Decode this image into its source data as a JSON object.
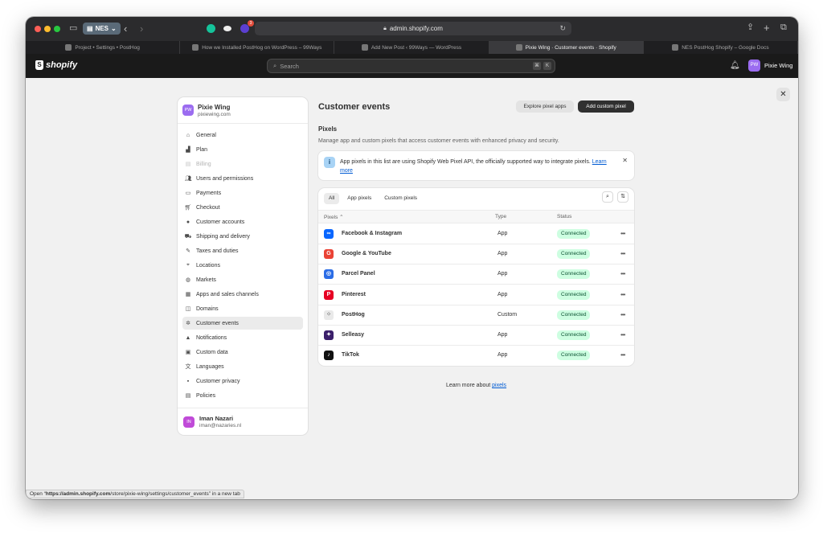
{
  "browser": {
    "profile": "NES",
    "extension_badge": "3",
    "address": "admin.shopify.com",
    "tabs": [
      {
        "label": "Project • Settings • PostHog",
        "active": false
      },
      {
        "label": "How we Installed PostHog on WordPress – 99Ways",
        "active": false
      },
      {
        "label": "Add New Post ‹ 99Ways — WordPress",
        "active": false
      },
      {
        "label": "Pixie Wing · Customer events · Shopify",
        "active": true
      },
      {
        "label": "NES PostHog Shopify – Google Docs",
        "active": false
      }
    ]
  },
  "topbar": {
    "logo": "shopify",
    "search_placeholder": "Search",
    "shortcut_keys": [
      "⌘",
      "K"
    ],
    "user_initials": "PW",
    "user_name": "Pixie Wing"
  },
  "sidebar": {
    "store_initials": "PW",
    "store_name": "Pixie Wing",
    "store_domain": "pixiewing.com",
    "items": [
      {
        "label": "General",
        "icon": "store-icon"
      },
      {
        "label": "Plan",
        "icon": "chart-icon"
      },
      {
        "label": "Billing",
        "icon": "receipt-icon",
        "disabled": true
      },
      {
        "label": "Users and permissions",
        "icon": "users-icon"
      },
      {
        "label": "Payments",
        "icon": "payment-icon"
      },
      {
        "label": "Checkout",
        "icon": "cart-icon"
      },
      {
        "label": "Customer accounts",
        "icon": "person-icon"
      },
      {
        "label": "Shipping and delivery",
        "icon": "truck-icon"
      },
      {
        "label": "Taxes and duties",
        "icon": "tax-icon"
      },
      {
        "label": "Locations",
        "icon": "location-icon"
      },
      {
        "label": "Markets",
        "icon": "globe-icon"
      },
      {
        "label": "Apps and sales channels",
        "icon": "apps-icon"
      },
      {
        "label": "Domains",
        "icon": "domain-icon"
      },
      {
        "label": "Customer events",
        "icon": "events-icon",
        "active": true
      },
      {
        "label": "Notifications",
        "icon": "bell-icon"
      },
      {
        "label": "Custom data",
        "icon": "data-icon"
      },
      {
        "label": "Languages",
        "icon": "language-icon"
      },
      {
        "label": "Customer privacy",
        "icon": "lock-icon"
      },
      {
        "label": "Policies",
        "icon": "policy-icon"
      }
    ],
    "user_initials": "IN",
    "user_name": "Iman Nazari",
    "user_email": "iman@nazaries.nl"
  },
  "main": {
    "title": "Customer events",
    "explore_button": "Explore pixel apps",
    "add_button": "Add custom pixel",
    "section_title": "Pixels",
    "section_description": "Manage app and custom pixels that access customer events with enhanced privacy and security.",
    "banner_text": "App pixels in this list are using Shopify Web Pixel API, the officially supported way to integrate pixels.",
    "banner_link": "Learn more",
    "filters": [
      {
        "label": "All",
        "active": true
      },
      {
        "label": "App pixels",
        "active": false
      },
      {
        "label": "Custom pixels",
        "active": false
      }
    ],
    "columns": {
      "pixels": "Pixels",
      "type": "Type",
      "status": "Status"
    },
    "pixels": [
      {
        "name": "Facebook & Instagram",
        "type": "App",
        "status": "Connected",
        "icon": "meta-icon",
        "color": "#0866ff",
        "glyph": "∞"
      },
      {
        "name": "Google & YouTube",
        "type": "App",
        "status": "Connected",
        "icon": "google-icon",
        "color": "#ea4335",
        "glyph": "G"
      },
      {
        "name": "Parcel Panel",
        "type": "App",
        "status": "Connected",
        "icon": "parcel-panel-icon",
        "color": "#2b6de6",
        "glyph": "◎"
      },
      {
        "name": "Pinterest",
        "type": "App",
        "status": "Connected",
        "icon": "pinterest-icon",
        "color": "#e60023",
        "glyph": "P"
      },
      {
        "name": "PostHog",
        "type": "Custom",
        "status": "Connected",
        "icon": "custom-pixel-icon",
        "color": "#e9e9e9",
        "glyph": "⁘"
      },
      {
        "name": "Selleasy",
        "type": "App",
        "status": "Connected",
        "icon": "selleasy-icon",
        "color": "#3b1f6b",
        "glyph": "✦"
      },
      {
        "name": "TikTok",
        "type": "App",
        "status": "Connected",
        "icon": "tiktok-icon",
        "color": "#111111",
        "glyph": "♪"
      }
    ],
    "footer_text": "Learn more about",
    "footer_link": "pixels"
  },
  "status_bar": {
    "prefix": "Open “",
    "url_host": "https://admin.shopify.com",
    "url_path": "/store/pixie-wing/settings/customer_events",
    "suffix": "” in a new tab"
  }
}
